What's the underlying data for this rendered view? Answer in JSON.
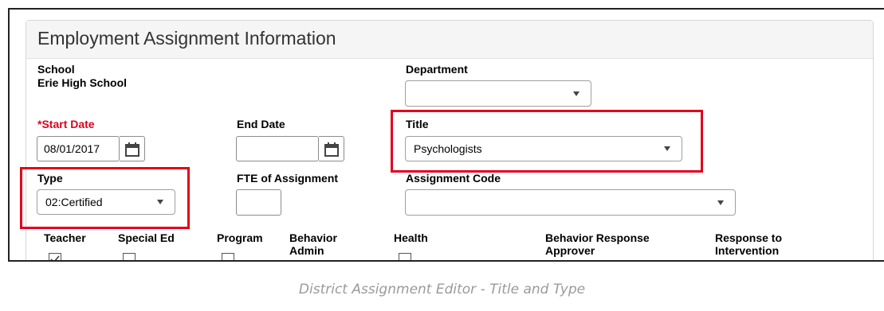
{
  "panel": {
    "title": "Employment Assignment Information"
  },
  "school": {
    "label": "School",
    "value": "Erie High School"
  },
  "department": {
    "label": "Department",
    "value": ""
  },
  "start_date": {
    "asterisk": "*",
    "label": "Start Date",
    "value": "08/01/2017"
  },
  "end_date": {
    "label": "End Date",
    "value": ""
  },
  "title_field": {
    "label": "Title",
    "value": "Psychologists"
  },
  "type_field": {
    "label": "Type",
    "value": "02:Certified"
  },
  "fte": {
    "label": "FTE of Assignment",
    "value": ""
  },
  "assignment_code": {
    "label": "Assignment Code",
    "value": ""
  },
  "checkboxes": [
    {
      "label": "Teacher",
      "checked": true
    },
    {
      "label": "Special Ed",
      "checked": false
    },
    {
      "label": "Program",
      "checked": false
    },
    {
      "label": "Behavior Admin",
      "checked": false
    },
    {
      "label": "Health",
      "checked": false
    },
    {
      "label": "Behavior Response Approver",
      "checked": false
    },
    {
      "label": "Response to Intervention",
      "checked": false
    }
  ],
  "caption": "District Assignment Editor - Title and Type",
  "colors": {
    "highlight": "#e4001b",
    "required": "#e0001b",
    "caption": "#9a9a9a"
  },
  "icons": {
    "calendar": "calendar-icon",
    "dropdown": "chevron-down-icon",
    "check": "check-icon"
  }
}
